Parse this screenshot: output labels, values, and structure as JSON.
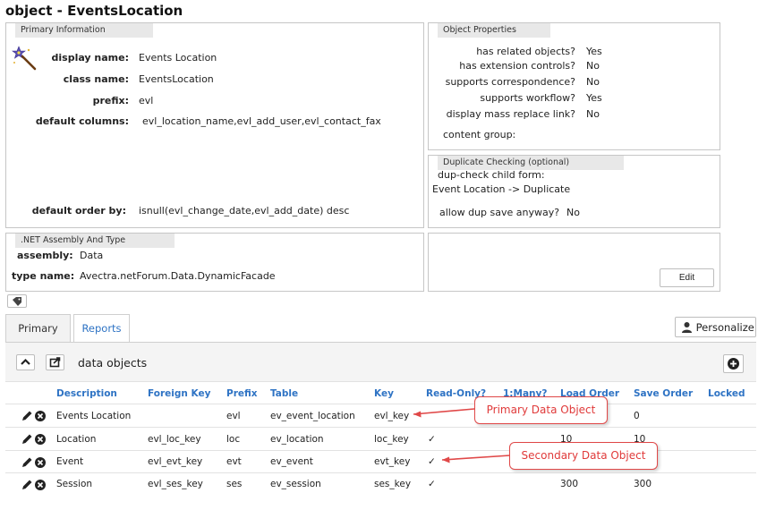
{
  "page": {
    "title": "object - EventsLocation"
  },
  "primary_info": {
    "header": "Primary Information",
    "fields": [
      {
        "label": "display name:",
        "value": "Events Location"
      },
      {
        "label": "class name:",
        "value": "EventsLocation"
      },
      {
        "label": "prefix:",
        "value": "evl"
      },
      {
        "label": "default columns:",
        "value": "evl_location_name,evl_add_user,evl_contact_fax"
      },
      {
        "label": "default order by:",
        "value": "isnull(evl_change_date,evl_add_date) desc"
      }
    ]
  },
  "object_properties": {
    "header": "Object Properties",
    "rows": [
      {
        "q": "has related objects?",
        "a": "Yes"
      },
      {
        "q": "has extension controls?",
        "a": "No"
      },
      {
        "q": "supports correspondence?",
        "a": "No"
      },
      {
        "q": "supports workflow?",
        "a": "Yes"
      },
      {
        "q": "display mass replace link?",
        "a": "No"
      }
    ],
    "content_group_label": "content group:"
  },
  "dup_check": {
    "header": "Duplicate Checking (optional)",
    "child_form_label": "dup-check child form:",
    "child_form_value": "Event Location -> Duplicate",
    "allow_label": "allow dup save anyway?",
    "allow_value": "No"
  },
  "net_assembly": {
    "header": ".NET Assembly And Type",
    "assembly_label": "assembly:",
    "assembly_value": "Data",
    "type_label": "type name:",
    "type_value": "Avectra.netForum.Data.DynamicFacade"
  },
  "edit_label": "Edit",
  "tabs": [
    {
      "label": "Primary",
      "active": false
    },
    {
      "label": "Reports",
      "active": true
    }
  ],
  "personalize_label": "Personalize",
  "data_objects": {
    "title": "data objects",
    "columns": [
      "Description",
      "Foreign Key",
      "Prefix",
      "Table",
      "Key",
      "Read-Only?",
      "1:Many?",
      "Load Order",
      "Save Order",
      "Locked"
    ],
    "rows": [
      {
        "description": "Events Location",
        "foreign_key": "",
        "prefix": "evl",
        "table": "ev_event_location",
        "key": "evl_key",
        "read_only": "",
        "one_many": "",
        "load_order": "",
        "save_order": "0",
        "locked": ""
      },
      {
        "description": "Location",
        "foreign_key": "evl_loc_key",
        "prefix": "loc",
        "table": "ev_location",
        "key": "loc_key",
        "read_only": "✓",
        "one_many": "",
        "load_order": "10",
        "save_order": "10",
        "locked": ""
      },
      {
        "description": "Event",
        "foreign_key": "evl_evt_key",
        "prefix": "evt",
        "table": "ev_event",
        "key": "evt_key",
        "read_only": "✓",
        "one_many": "",
        "load_order": "",
        "save_order": "",
        "locked": ""
      },
      {
        "description": "Session",
        "foreign_key": "evl_ses_key",
        "prefix": "ses",
        "table": "ev_session",
        "key": "ses_key",
        "read_only": "✓",
        "one_many": "",
        "load_order": "300",
        "save_order": "300",
        "locked": ""
      }
    ]
  },
  "callouts": {
    "primary": "Primary Data Object",
    "secondary": "Secondary Data Object"
  },
  "colors": {
    "link": "#2e73c4",
    "callout": "#e03a3a"
  }
}
